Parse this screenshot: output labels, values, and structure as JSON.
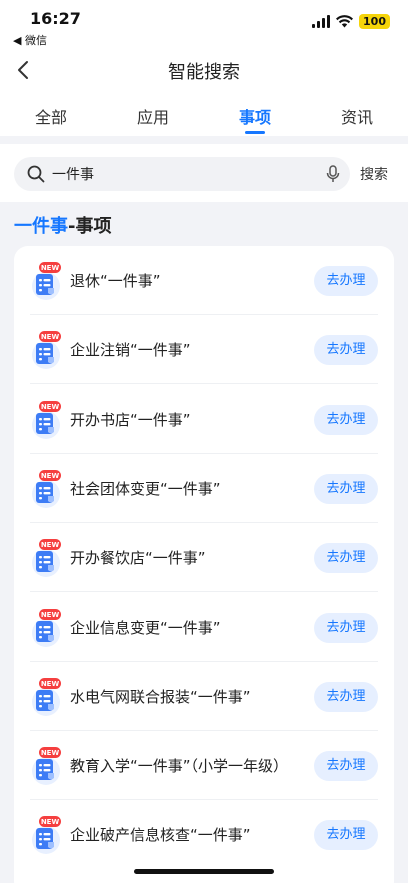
{
  "status_bar": {
    "time": "16:27",
    "back_app": "◀ 微信",
    "battery": "100"
  },
  "nav": {
    "title": "智能搜索"
  },
  "tabs": [
    {
      "label": "全部",
      "active": false
    },
    {
      "label": "应用",
      "active": false
    },
    {
      "label": "事项",
      "active": true
    },
    {
      "label": "资讯",
      "active": false
    }
  ],
  "search": {
    "value": "一件事",
    "button_label": "搜索"
  },
  "section": {
    "highlight": "一件事",
    "rest": "-事项"
  },
  "badge_text": "NEW",
  "items": [
    {
      "title": "退休“一件事”",
      "action": "去办理"
    },
    {
      "title": "企业注销“一件事”",
      "action": "去办理"
    },
    {
      "title": "开办书店“一件事”",
      "action": "去办理"
    },
    {
      "title": "社会团体变更“一件事”",
      "action": "去办理"
    },
    {
      "title": "开办餐饮店“一件事”",
      "action": "去办理"
    },
    {
      "title": "企业信息变更“一件事”",
      "action": "去办理"
    },
    {
      "title": "水电气网联合报装“一件事”",
      "action": "去办理"
    },
    {
      "title": "教育入学“一件事”（小学一年级）",
      "action": "去办理"
    },
    {
      "title": "企业破产信息核查“一件事”",
      "action": "去办理"
    }
  ],
  "colors": {
    "accent": "#1677ff",
    "badge": "#f53f3f",
    "button_bg": "#e6efff"
  }
}
